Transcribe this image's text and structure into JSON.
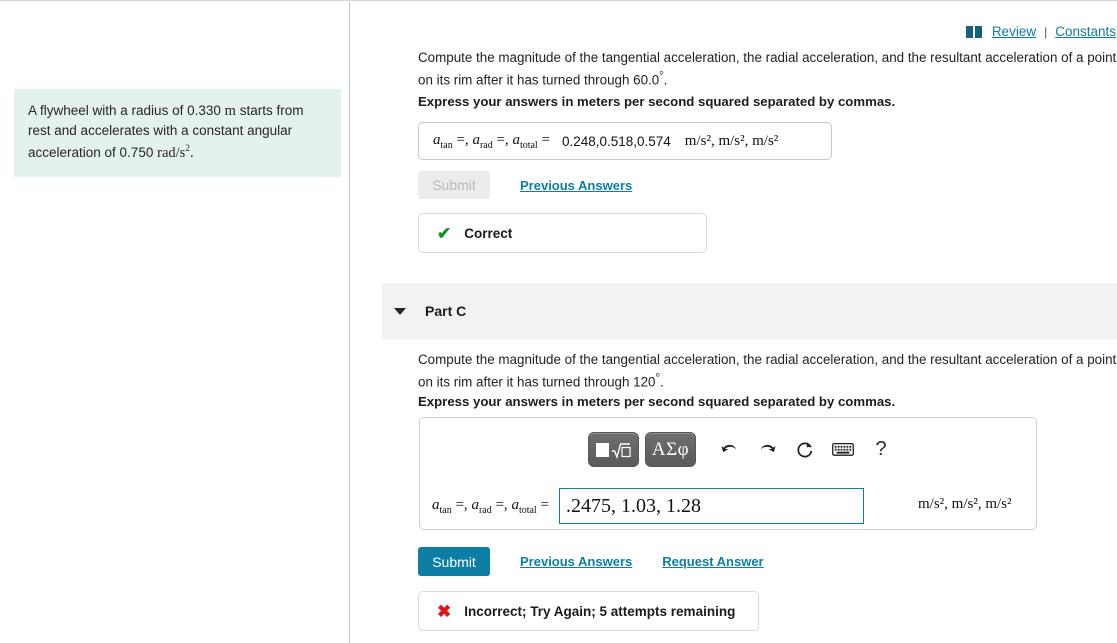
{
  "top_links": {
    "book_icon": "book-icon",
    "review_label": "Review",
    "separator": "|",
    "constants_label": "Constants"
  },
  "problem_statement": {
    "line1": "A flywheel with a radius of 0.330",
    "unit_m": "m",
    "line1_cont": "starts from rest",
    "line2": "and accelerates with a constant angular",
    "line3": "acceleration of 0.750",
    "unit_rad": "rad/s",
    "unit_rad_exp": "2",
    "period": "."
  },
  "part_b": {
    "question_line1": "Compute the magnitude of the tangential acceleration, the radial acceleration, and the resultant acceleration of a point on",
    "question_line2_pre": "its rim after it has turned through 60.0",
    "degree": "°",
    "question_line2_post": ".",
    "instruction": "Express your answers in meters per second squared separated by commas.",
    "label_a": "a",
    "label_tan": "tan",
    "label_eq": " =, ",
    "label_rad": "rad",
    "label_total": "total",
    "label_eq_last": " = ",
    "answer_value": "0.248,0.518,0.574",
    "units": "m/s², m/s², m/s²",
    "submit_label": "Submit",
    "submit_enabled": "false",
    "previous_answers_label": "Previous Answers",
    "status_icon": "check-icon",
    "status_text": "Correct"
  },
  "part_c": {
    "header_label": "Part C",
    "caret_icon": "chevron-down-icon",
    "question_line1": "Compute the magnitude of the tangential acceleration, the radial acceleration, and the resultant acceleration of a point on",
    "question_line2_pre": "its rim after it has turned through 120",
    "degree": "°",
    "question_line2_post": ".",
    "instruction": "Express your answers in meters per second squared separated by commas.",
    "toolbar": {
      "template_button": "math-template-button",
      "greek_button_label": "ΑΣφ",
      "undo_icon": "undo-arrow-icon",
      "redo_icon": "redo-arrow-icon",
      "reset_icon": "reset-circular-arrow-icon",
      "keyboard_icon": "keyboard-icon",
      "help_label": "?"
    },
    "label_a": "a",
    "label_tan": "tan",
    "label_rad": "rad",
    "label_total": "total",
    "input_value": ".2475, 1.03, 1.28",
    "units": "m/s², m/s², m/s²",
    "submit_label": "Submit",
    "previous_answers_label": "Previous Answers",
    "request_answer_label": "Request Answer",
    "status_icon": "cross-icon",
    "status_text": "Incorrect; Try Again; 5 attempts remaining"
  },
  "colors": {
    "accent_teal": "#0d7ea4",
    "problem_bg": "#e3f1ef",
    "correct_green": "#14912f",
    "incorrect_red": "#e0141b",
    "band_grey": "#f2f2f2"
  }
}
